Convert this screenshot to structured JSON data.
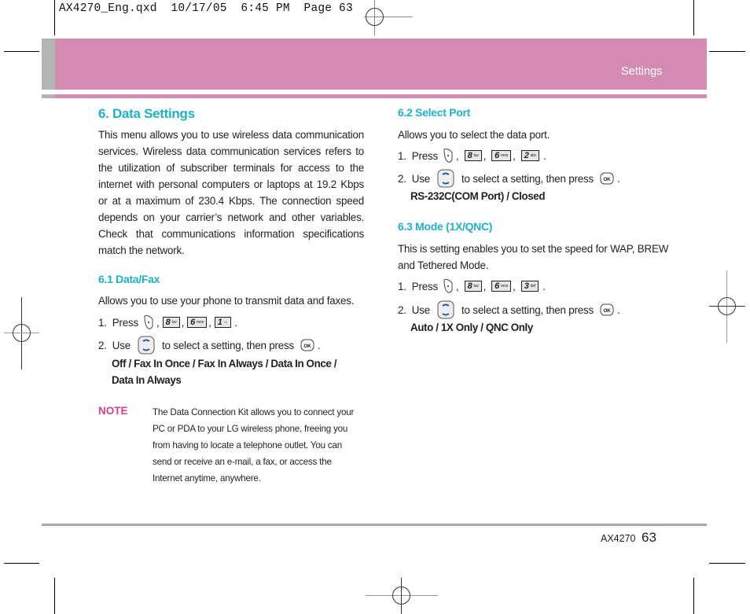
{
  "slug": "AX4270_Eng.qxd  10/17/05  6:45 PM  Page 63",
  "header": {
    "section_title": "Settings",
    "colors": {
      "band": "#d48bb1",
      "tab": "#b5b4b4"
    }
  },
  "left_column": {
    "title": "6. Data Settings",
    "intro": "This menu allows you to use wireless data communication services. Wireless data communication services refers to the utilization of subscriber terminals for access to the internet with personal computers or laptops at 19.2 Kbps or at a maximum of 230.4 Kbps. The connection speed depends on your carrier’s network and other variables. Check that communications information specifications match the network.",
    "subsection": {
      "title": "6.1 Data/Fax",
      "description": "Allows you to use your phone to transmit data and faxes.",
      "step1_prefix": "1.  Press",
      "keys": [
        {
          "digit": "8",
          "letters": "tuv"
        },
        {
          "digit": "6",
          "letters": "mno"
        },
        {
          "digit": "1",
          "letters": "☺"
        }
      ],
      "step2_prefix": "2.  Use",
      "step2_middle": "to select a setting, then press",
      "options_line1": "Off / Fax In Once / Fax In Always / Data In Once /",
      "options_line2": "Data In Always"
    },
    "note": {
      "label": "NOTE",
      "lines": [
        "The Data Connection Kit allows you to connect your",
        "PC or PDA to your LG wireless phone, freeing you",
        "from having to locate a telephone outlet. You can",
        "send or receive an e-mail, a fax, or access the",
        "Internet anytime, anywhere."
      ]
    }
  },
  "right_column": {
    "select_port": {
      "title": "6.2 Select Port",
      "description": "Allows you to select the data port.",
      "step1_prefix": "1.  Press",
      "keys": [
        {
          "digit": "8",
          "letters": "tuv"
        },
        {
          "digit": "6",
          "letters": "mno"
        },
        {
          "digit": "2",
          "letters": "abc"
        }
      ],
      "step2_prefix": "2.  Use",
      "step2_middle": "to select a setting, then press",
      "options": "RS-232C(COM Port) / Closed"
    },
    "mode": {
      "title": "6.3 Mode (1X/QNC)",
      "description_line1": "This is setting enables you to set the speed for WAP, BREW",
      "description_line2": "and Tethered Mode.",
      "step1_prefix": "1.  Press",
      "keys": [
        {
          "digit": "8",
          "letters": "tuv"
        },
        {
          "digit": "6",
          "letters": "mno"
        },
        {
          "digit": "3",
          "letters": "def"
        }
      ],
      "step2_prefix": "2.  Use",
      "step2_middle": "to select a setting, then press",
      "options": "Auto / 1X Only / QNC Only"
    }
  },
  "footer": {
    "model": "AX4270",
    "page_number": "63"
  },
  "symbols": {
    "comma": ",",
    "period": ".",
    "ok": "OK"
  }
}
